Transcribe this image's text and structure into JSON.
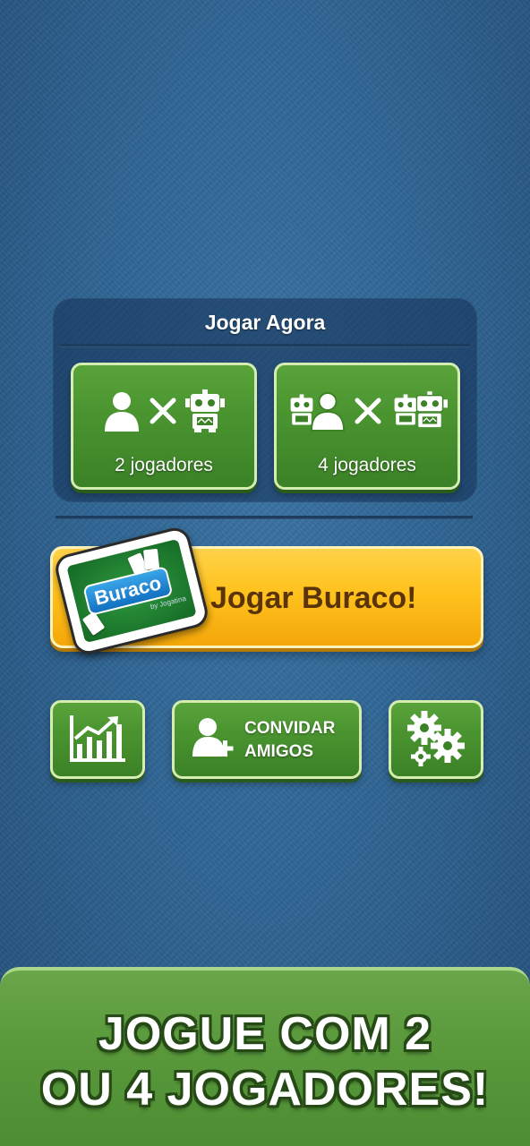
{
  "panel": {
    "title": "Jogar Agora",
    "modes": [
      {
        "label": "2 jogadores",
        "icons": [
          "person-icon",
          "versus-icon",
          "robot-icon"
        ]
      },
      {
        "label": "4 jogadores",
        "icons": [
          "robot-icon",
          "person-icon",
          "versus-icon",
          "robot-icon",
          "robot-icon"
        ]
      }
    ]
  },
  "play_button": {
    "label": "Jogar Buraco!",
    "logo_text": "Buraco",
    "logo_sub": "by Jogatina"
  },
  "bottom_buttons": {
    "stats_icon": "chart-icon",
    "invite_label_line1": "CONVIDAR",
    "invite_label_line2": "AMIGOS",
    "invite_icon": "add-user-icon",
    "settings_icon": "gears-icon"
  },
  "banner": {
    "line1": "JOGUE COM 2",
    "line2": "OU 4 JOGADORES!"
  },
  "colors": {
    "background": "#2f6594",
    "green_button": "#4a9430",
    "yellow_button": "#ffc21d",
    "banner_green": "#5a9a3c"
  }
}
